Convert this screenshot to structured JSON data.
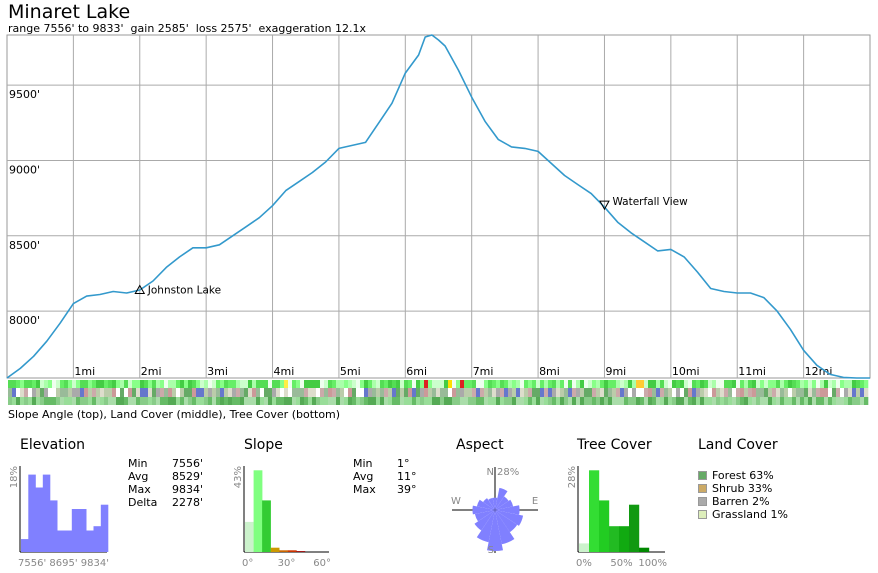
{
  "header": {
    "title": "Minaret Lake",
    "subtitle": "range 7556' to 9833'  gain 2585'  loss 2575'  exaggeration 12.1x"
  },
  "chart_data": {
    "type": "line",
    "title": "Minaret Lake",
    "y_unit": "feet",
    "x_unit": "miles",
    "xlim": [
      0,
      13.0
    ],
    "ylim": [
      7556,
      9833
    ],
    "y_ticks": [
      8000,
      8500,
      9000,
      9500
    ],
    "y_tick_labels": [
      "8000'",
      "8500'",
      "9000'",
      "9500'"
    ],
    "x_ticks": [
      1,
      2,
      3,
      4,
      5,
      6,
      7,
      8,
      9,
      10,
      11,
      12
    ],
    "x_tick_labels": [
      "1mi",
      "2mi",
      "3mi",
      "4mi",
      "5mi",
      "6mi",
      "7mi",
      "8mi",
      "9mi",
      "10mi",
      "11mi",
      "12mi"
    ],
    "grid": true,
    "line_color": "#3399cc",
    "series": [
      {
        "x": [
          0,
          0.2,
          0.4,
          0.6,
          0.8,
          1.0,
          1.2,
          1.4,
          1.6,
          1.8,
          2.0,
          2.2,
          2.4,
          2.6,
          2.8,
          3.0,
          3.2,
          3.4,
          3.6,
          3.8,
          4.0,
          4.2,
          4.4,
          4.6,
          4.8,
          5.0,
          5.2,
          5.4,
          5.6,
          5.8,
          6.0,
          6.2,
          6.3,
          6.4,
          6.5,
          6.6,
          6.8,
          7.0,
          7.2,
          7.4,
          7.6,
          7.8,
          8.0,
          8.2,
          8.4,
          8.6,
          8.8,
          9.0,
          9.2,
          9.4,
          9.6,
          9.8,
          10.0,
          10.2,
          10.4,
          10.6,
          10.8,
          11.0,
          11.2,
          11.4,
          11.6,
          11.8,
          12.0,
          12.2,
          12.4,
          12.6,
          12.8,
          13.0
        ],
        "y": [
          7556,
          7620,
          7700,
          7800,
          7920,
          8050,
          8100,
          8110,
          8130,
          8120,
          8140,
          8200,
          8290,
          8360,
          8420,
          8420,
          8440,
          8500,
          8560,
          8620,
          8700,
          8800,
          8860,
          8920,
          8990,
          9080,
          9100,
          9120,
          9250,
          9380,
          9580,
          9700,
          9820,
          9833,
          9800,
          9760,
          9600,
          9420,
          9260,
          9140,
          9090,
          9080,
          9060,
          8980,
          8900,
          8840,
          8780,
          8690,
          8590,
          8520,
          8460,
          8400,
          8410,
          8360,
          8260,
          8150,
          8130,
          8120,
          8120,
          8090,
          8000,
          7880,
          7740,
          7640,
          7580,
          7560,
          7556,
          7556
        ]
      }
    ],
    "annotations": [
      {
        "label": "Johnston Lake",
        "x": 2.0,
        "y": 8130,
        "marker": "triangle-up"
      },
      {
        "label": "Waterfall View",
        "x": 9.0,
        "y": 8690,
        "marker": "triangle-down"
      }
    ]
  },
  "strips": {
    "caption": "Slope Angle (top), Land Cover (middle), Tree Cover (bottom)"
  },
  "panels": {
    "elevation": {
      "title": "Elevation",
      "y_max_label": "18%",
      "x_labels": [
        "7556'",
        "8695'",
        "9834'"
      ],
      "color": "#8080ff",
      "histogram": [
        0.15,
        0.9,
        0.75,
        0.9,
        0.6,
        0.25,
        0.25,
        0.5,
        0.5,
        0.25,
        0.3,
        0.55
      ],
      "stats": [
        {
          "label": "Min",
          "value": "7556'"
        },
        {
          "label": "Avg",
          "value": "8529'"
        },
        {
          "label": "Max",
          "value": "9834'"
        },
        {
          "label": "Delta",
          "value": "2278'"
        }
      ]
    },
    "slope": {
      "title": "Slope",
      "y_max_label": "43%",
      "x_labels": [
        "0°",
        "30°",
        "60°"
      ],
      "histogram": [
        0.35,
        0.95,
        0.6,
        0.05,
        0.02,
        0.02,
        0.01
      ],
      "bar_colors": [
        "#ccf2cc",
        "#80ff80",
        "#33cc33",
        "#cc9900",
        "#cc6600",
        "#cc3300",
        "#990000"
      ],
      "stats": [
        {
          "label": "Min",
          "value": "1°"
        },
        {
          "label": "Avg",
          "value": "11°"
        },
        {
          "label": "Max",
          "value": "39°"
        }
      ]
    },
    "aspect": {
      "title": "Aspect",
      "pct_label": "28%",
      "north": "N",
      "south": "S",
      "east": "E",
      "west": "W",
      "color": "#8080ff",
      "sectors": [
        0.3,
        0.55,
        0.4,
        0.45,
        0.6,
        0.7,
        0.65,
        0.85,
        1.0,
        0.8,
        0.6,
        0.5,
        0.55,
        0.45,
        0.35,
        0.3
      ]
    },
    "tree_cover": {
      "title": "Tree Cover",
      "y_max_label": "28%",
      "x_labels": [
        "0%",
        "50%",
        "100%"
      ],
      "histogram": [
        0.1,
        0.95,
        0.6,
        0.3,
        0.3,
        0.55,
        0.05
      ],
      "bar_colors": [
        "#ccf2cc",
        "#33dd33",
        "#22cc22",
        "#22bb22",
        "#11aa11",
        "#119911",
        "#008800"
      ]
    },
    "land_cover": {
      "title": "Land Cover",
      "items": [
        {
          "label": "Forest 63%",
          "color": "#66aa66"
        },
        {
          "label": "Shrub 33%",
          "color": "#ccaa66"
        },
        {
          "label": "Barren 2%",
          "color": "#aaaaaa"
        },
        {
          "label": "Grassland 1%",
          "color": "#ddeebb"
        }
      ]
    }
  }
}
